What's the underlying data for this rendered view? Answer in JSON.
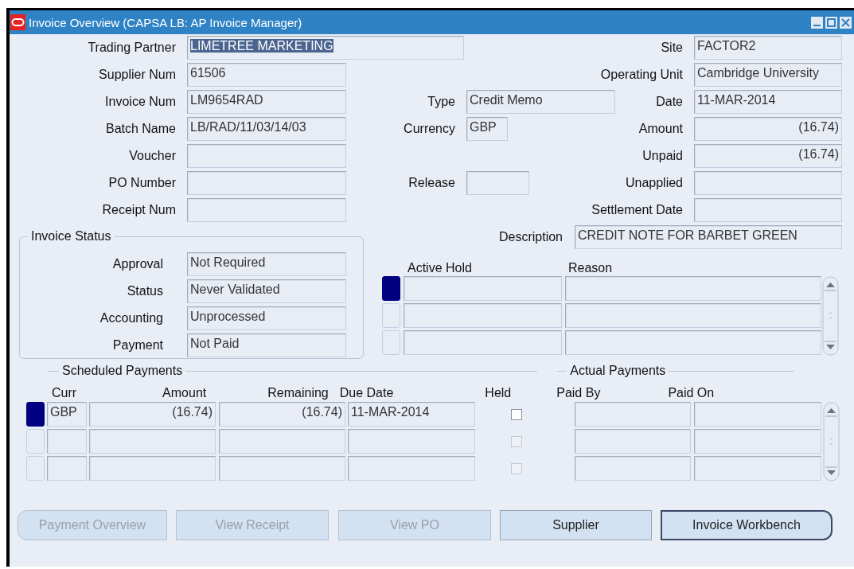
{
  "window": {
    "title": "Invoice Overview (CAPSA LB: AP Invoice Manager)"
  },
  "fields": [
    {
      "label": "Trading Partner",
      "value": "LIMETREE MARKETING",
      "highlighted": true
    },
    {
      "label": "Site",
      "value": "FACTOR2"
    },
    {
      "label": "Supplier Num",
      "value": "61506"
    },
    {
      "label": "Operating Unit",
      "value": "Cambridge University"
    },
    {
      "label": "Invoice Num",
      "value": "LM9654RAD"
    },
    {
      "label": "Type",
      "value": "Credit Memo"
    },
    {
      "label": "Date",
      "value": "11-MAR-2014"
    },
    {
      "label": "Batch Name",
      "value": "LB/RAD/11/03/14/03"
    },
    {
      "label": "Currency",
      "value": "GBP"
    },
    {
      "label": "Amount",
      "value": "(16.74)"
    },
    {
      "label": "Voucher"
    },
    {
      "label": "Unpaid",
      "value": "(16.74)"
    },
    {
      "label": "PO Number"
    },
    {
      "label": "Release"
    },
    {
      "label": "Unapplied"
    },
    {
      "label": "Receipt Num"
    },
    {
      "label": "Settlement Date"
    },
    {
      "label": "Description",
      "value": "CREDIT NOTE FOR BARBET GREEN"
    }
  ],
  "invoice_status": {
    "title": "Invoice Status",
    "fields": [
      {
        "label": "Approval",
        "value": "Not Required"
      },
      {
        "label": "Status",
        "value": "Never Validated"
      },
      {
        "label": "Accounting",
        "value": "Unprocessed"
      },
      {
        "label": "Payment",
        "value": "Not Paid"
      }
    ]
  },
  "holds": {
    "columns": [
      "Active Hold",
      "Reason"
    ],
    "rows": [
      {
        "selected": true
      },
      {
        "selected": false
      },
      {
        "selected": false
      }
    ]
  },
  "scheduled_payments": {
    "title": "Scheduled Payments",
    "columns": [
      "Curr",
      "Amount",
      "Remaining",
      "Due Date",
      "Held"
    ],
    "rows": [
      {
        "selected": true,
        "curr": "GBP",
        "amount": "(16.74)",
        "remaining": "(16.74)",
        "due_date": "11-MAR-2014",
        "held": false,
        "disabled": false
      },
      {
        "selected": false,
        "held": false,
        "disabled": true
      },
      {
        "selected": false,
        "held": false,
        "disabled": true
      }
    ]
  },
  "actual_payments": {
    "title": "Actual Payments",
    "columns": [
      "Paid By",
      "Paid On"
    ]
  },
  "buttons": [
    {
      "label": "Payment Overview",
      "disabled": true,
      "focused": false
    },
    {
      "label": "View Receipt",
      "disabled": true,
      "focused": false
    },
    {
      "label": "View PO",
      "disabled": true,
      "focused": false
    },
    {
      "label": "Supplier",
      "disabled": false,
      "focused": false
    },
    {
      "label": "Invoice Workbench",
      "disabled": false,
      "focused": true
    }
  ]
}
